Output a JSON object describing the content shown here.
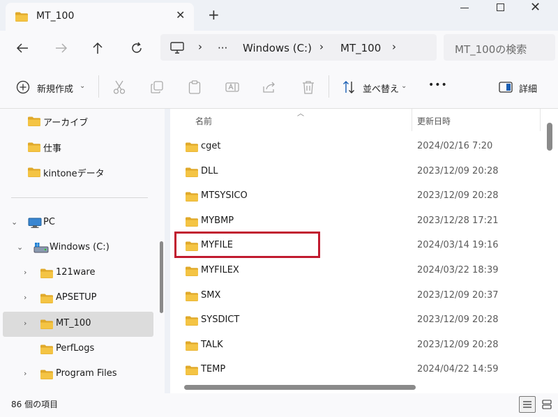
{
  "window": {
    "tab_title": "MT_100",
    "tab_close": "✕",
    "new_tab": "+"
  },
  "address": {
    "more": "···",
    "segments": [
      "Windows (C:)",
      "MT_100"
    ],
    "search_placeholder": "MT_100の検索"
  },
  "toolbar": {
    "new_label": "新規作成",
    "sort_label": "並べ替え",
    "more": "•••",
    "details_label": "詳細"
  },
  "sidebar": {
    "quick_access": [
      {
        "label": "アーカイブ"
      },
      {
        "label": "仕事"
      },
      {
        "label": "kintoneデータ"
      }
    ],
    "pc_label": "PC",
    "drive_label": "Windows (C:)",
    "drive_children": [
      {
        "label": "121ware",
        "has_children": true
      },
      {
        "label": "APSETUP",
        "has_children": true
      },
      {
        "label": "MT_100",
        "has_children": true,
        "selected": true
      },
      {
        "label": "PerfLogs",
        "has_children": false
      },
      {
        "label": "Program Files",
        "has_children": true
      }
    ]
  },
  "file_list": {
    "col_name": "名前",
    "col_date": "更新日時",
    "rows": [
      {
        "name": "cget",
        "date": "2024/02/16 7:20"
      },
      {
        "name": "DLL",
        "date": "2023/12/09 20:28"
      },
      {
        "name": "MTSYSICO",
        "date": "2023/12/09 20:28"
      },
      {
        "name": "MYBMP",
        "date": "2023/12/28 17:21"
      },
      {
        "name": "MYFILE",
        "date": "2024/03/14 19:16",
        "highlighted": true
      },
      {
        "name": "MYFILEX",
        "date": "2024/03/22 18:39"
      },
      {
        "name": "SMX",
        "date": "2023/12/09 20:37"
      },
      {
        "name": "SYSDICT",
        "date": "2023/12/09 20:28"
      },
      {
        "name": "TALK",
        "date": "2023/12/09 20:28"
      },
      {
        "name": "TEMP",
        "date": "2024/04/22 14:59"
      }
    ]
  },
  "status": {
    "item_count": "86 個の項目"
  },
  "colors": {
    "folder": "#f4c444",
    "folder_dark": "#e0a92a",
    "highlight_border": "#c11b2f",
    "selection": "#dcdcdc"
  }
}
